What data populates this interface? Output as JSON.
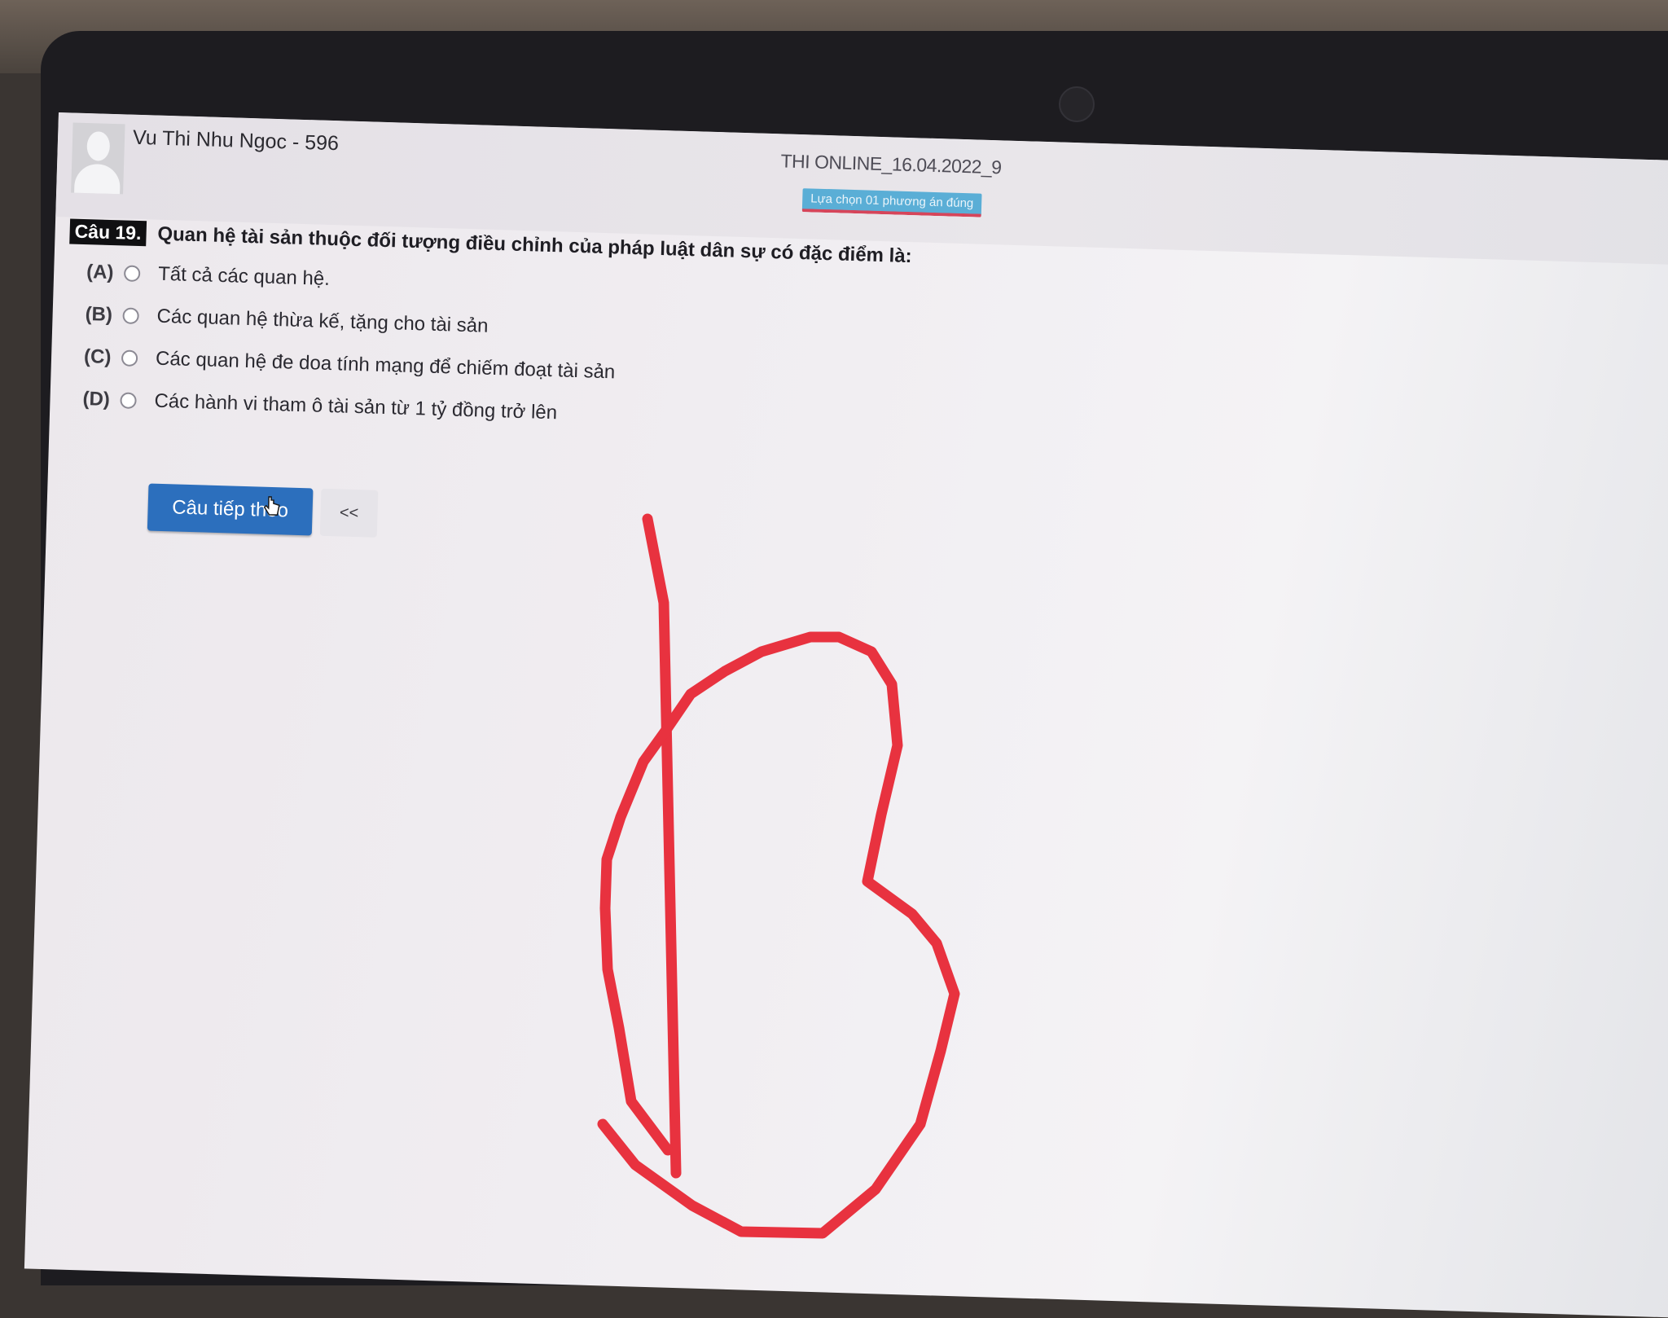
{
  "header": {
    "student_name": "Vu Thi Nhu Ngoc - 596",
    "exam_title": "THI ONLINE_16.04.2022_9",
    "instruction": "Lựa chọn 01 phương án đúng"
  },
  "question": {
    "number_label": "Câu 19.",
    "text": "Quan hệ tài sản thuộc đối tượng điều chỉnh của pháp luật dân sự có đặc điểm là:",
    "options": [
      {
        "letter": "(A)",
        "text": "Tất cả các quan hệ."
      },
      {
        "letter": "(B)",
        "text": "Các quan hệ thừa kế, tặng cho tài sản"
      },
      {
        "letter": "(C)",
        "text": "Các quan hệ đe doa tính mạng để chiếm đoạt tài sản"
      },
      {
        "letter": "(D)",
        "text": "Các hành vi tham ô tài sản từ 1 tỷ đồng trở lên"
      }
    ]
  },
  "navigation": {
    "next_label": "Câu tiếp theo",
    "prev_label": "<<"
  },
  "annotation": {
    "handwritten_mark": "b",
    "stroke_color": "#e8323f"
  },
  "colors": {
    "primary_button": "#2c6fbd",
    "badge": "#5aaed6"
  }
}
